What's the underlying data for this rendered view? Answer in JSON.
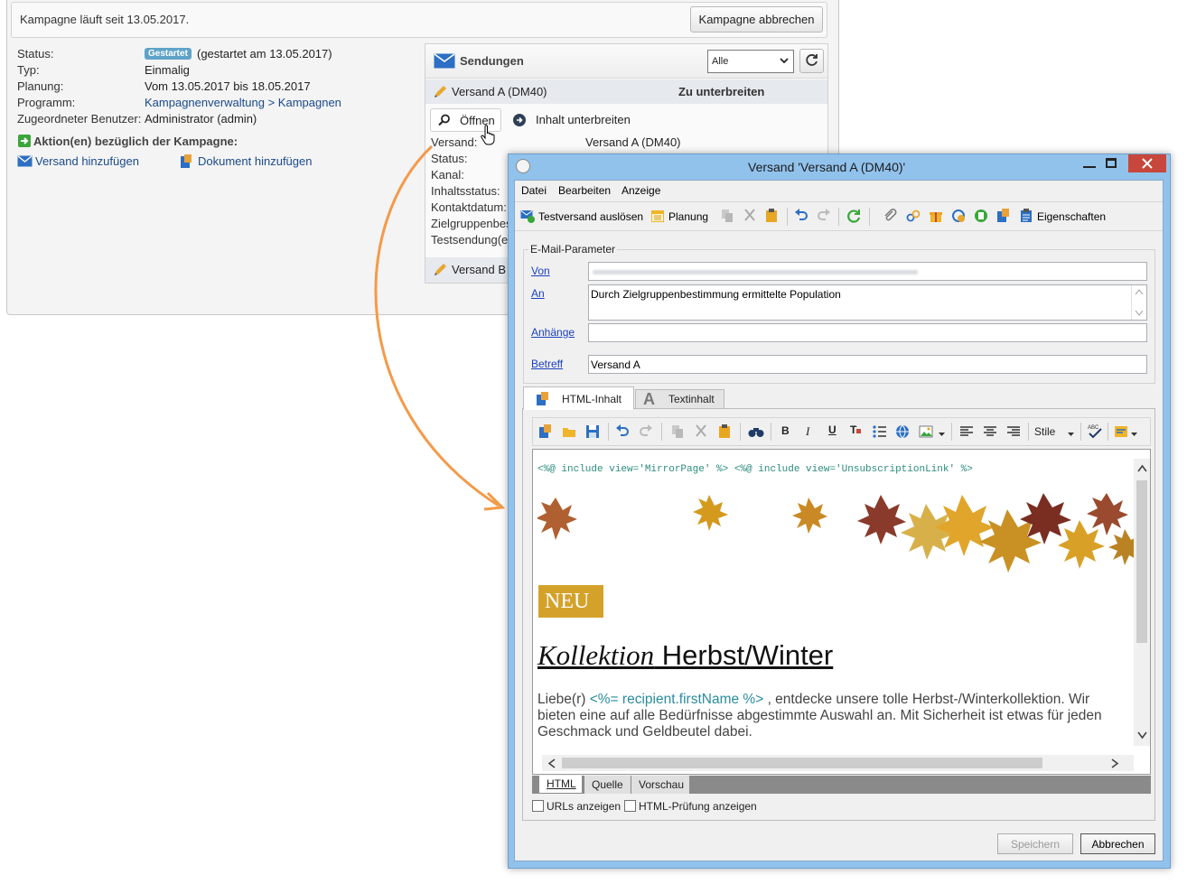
{
  "campaign": {
    "running_since": "Kampagne läuft seit 13.05.2017.",
    "cancel_button": "Kampagne abbrechen",
    "status_label": "Status:",
    "status_badge": "Gestartet",
    "status_value": "(gestartet am 13.05.2017)",
    "type_label": "Typ:",
    "type_value": "Einmalig",
    "planning_label": "Planung:",
    "planning_value": "Vom 13.05.2017 bis 18.05.2017",
    "program_label": "Programm:",
    "program_value": "Kampagnenverwaltung > Kampagnen",
    "user_label": "Zugeordneter Benutzer:",
    "user_value": "Administrator (admin)",
    "actions_title": "Aktion(en) bezüglich der Kampagne:",
    "add_delivery": "Versand hinzufügen",
    "add_document": "Dokument hinzufügen"
  },
  "deliveries": {
    "title": "Sendungen",
    "filter_value": "Alle",
    "filter_options": [
      "Alle"
    ],
    "item_name": "Versand A (DM40)",
    "item_status": "Zu unterbreiten",
    "open_button": "Öffnen",
    "submit_content": "Inhalt unterbreiten",
    "detail_labels": [
      "Versand:",
      "Status:",
      "Kanal:",
      "Inhaltsstatus:",
      "Kontaktdatum:",
      "Zielgruppenbes",
      "Testsendung(e"
    ],
    "detail_versand_value": "Versand A (DM40)",
    "item2_name": "Versand B"
  },
  "dialog": {
    "title": "Versand 'Versand A (DM40)'",
    "menu": [
      "Datei",
      "Bearbeiten",
      "Anzeige"
    ],
    "toolbar": {
      "test_send": "Testversand auslösen",
      "planning": "Planung",
      "properties": "Eigenschaften"
    },
    "email_params": {
      "legend": "E-Mail-Parameter",
      "from_label": "Von",
      "from_value": "",
      "to_label": "An",
      "to_value": "Durch Zielgruppenbestimmung ermittelte Population",
      "attachments_label": "Anhänge",
      "attachments_value": "",
      "subject_label": "Betreff",
      "subject_value": "Versand A"
    },
    "tabs": [
      "HTML-Inhalt",
      "Textinhalt"
    ],
    "editor_toolbar": {
      "styles_label": "Stile"
    },
    "content": {
      "include_line": "<%@ include view='MirrorPage' %> <%@ include view='UnsubscriptionLink' %>",
      "badge": "NEU",
      "heading_italic": "Kollektion",
      "heading_rest": " Herbst/Winter",
      "greeting_start": "Liebe(r) ",
      "personalization": "<%= recipient.firstName %>",
      "greeting_rest": " , entdecke unsere tolle Herbst-/Winterkollektion. Wir bieten eine auf alle Bedürfnisse abgestimmte Auswahl an. Mit Sicherheit ist etwas für jeden Geschmack und Geldbeutel dabei."
    },
    "view_tabs": [
      "HTML",
      "Quelle",
      "Vorschau"
    ],
    "show_urls": "URLs anzeigen",
    "show_html_check": "HTML-Prüfung anzeigen",
    "save_button": "Speichern",
    "cancel_button": "Abbrechen"
  },
  "colors": {
    "accent_orange": "#f39a4a",
    "badge_gold": "#d4a22a",
    "dialog_frame": "#91c2ec",
    "link_blue": "#1a4a8a",
    "close_red": "#c7473c"
  }
}
